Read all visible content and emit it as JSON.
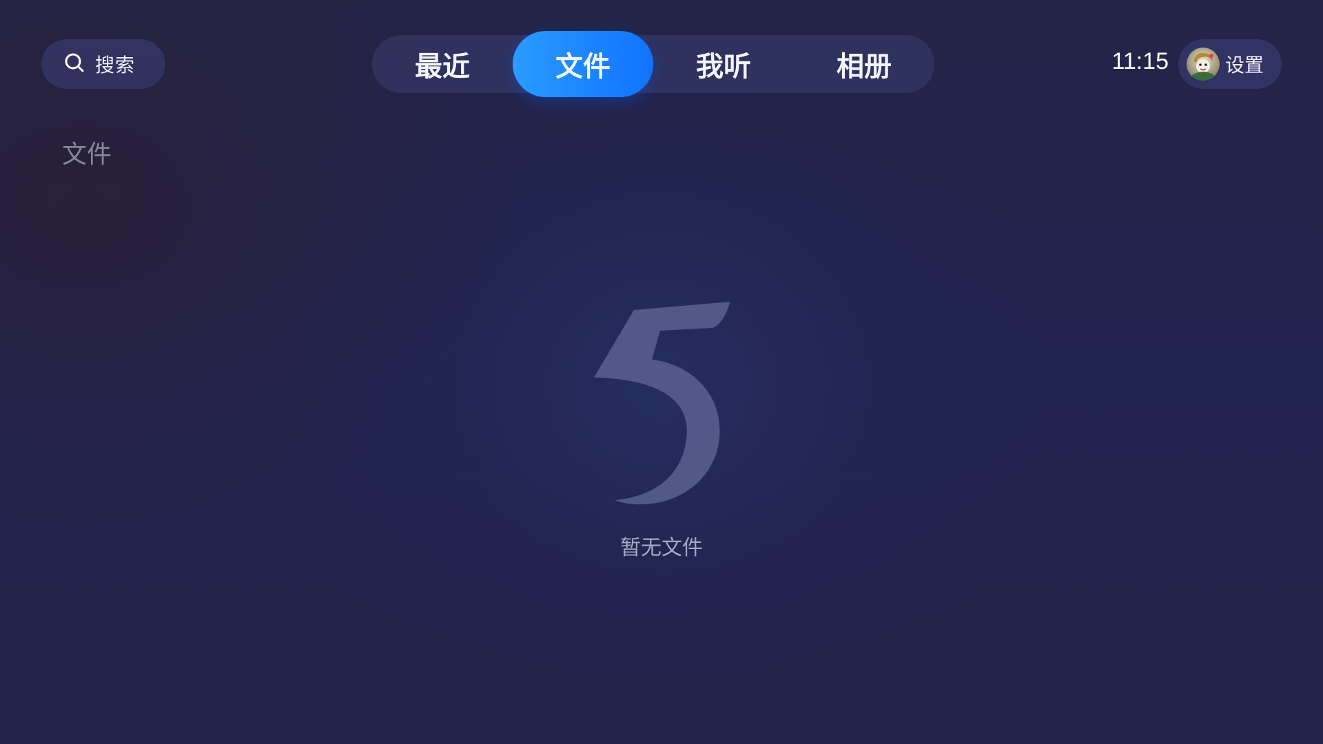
{
  "search": {
    "label": "搜索",
    "icon": "search-icon"
  },
  "tabs": [
    {
      "label": "最近",
      "active": false
    },
    {
      "label": "文件",
      "active": true
    },
    {
      "label": "我听",
      "active": false
    },
    {
      "label": "相册",
      "active": false
    }
  ],
  "clock": {
    "time": "11:15"
  },
  "settings": {
    "label": "设置",
    "avatar_icon": "avatar"
  },
  "section": {
    "title": "文件"
  },
  "empty_state": {
    "logo_glyph": "5",
    "message": "暂无文件"
  },
  "colors": {
    "accent": "#1a86ff",
    "background": "#232449",
    "pill": "#3e4278"
  }
}
